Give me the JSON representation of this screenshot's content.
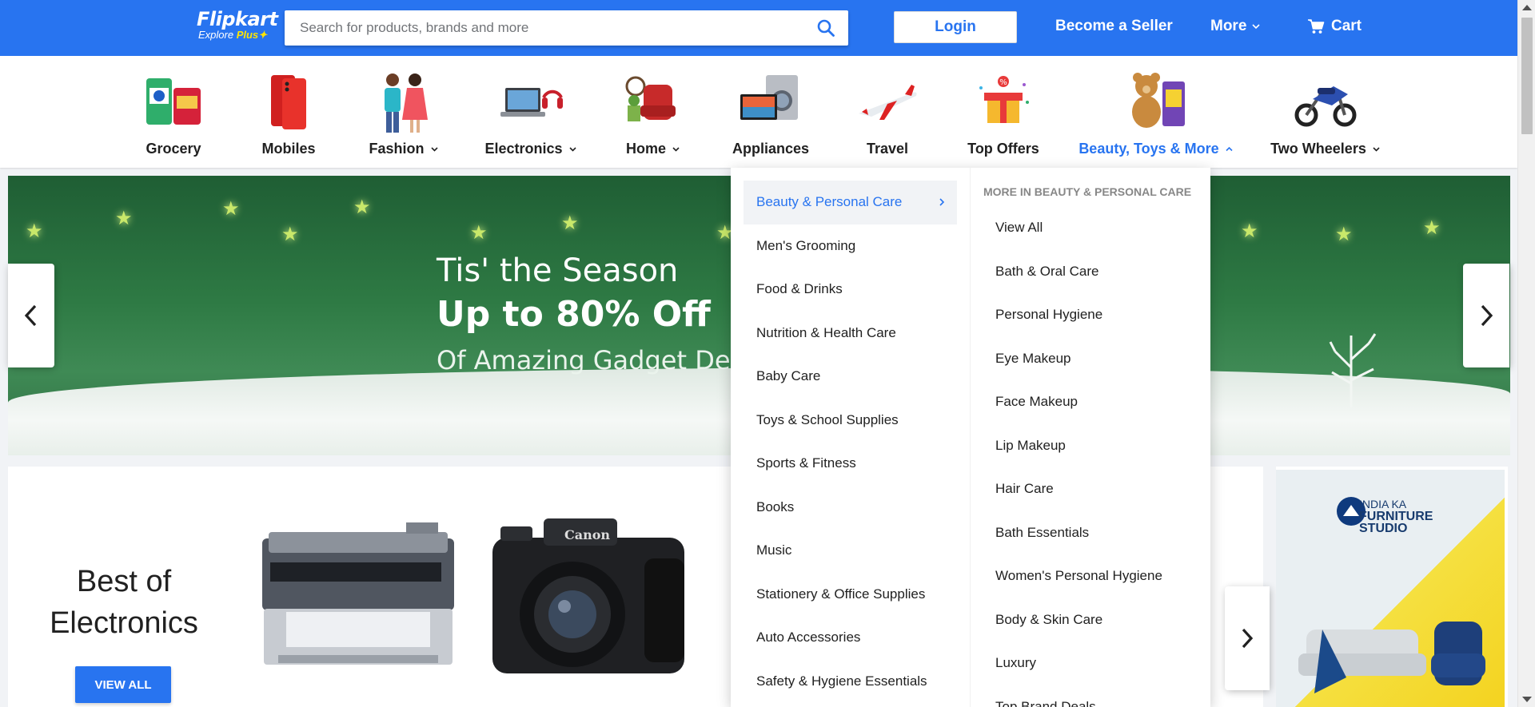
{
  "header": {
    "logo_text": "Flipkart",
    "logo_sub": "Explore",
    "logo_plus": "Plus",
    "search_placeholder": "Search for products, brands and more",
    "login_label": "Login",
    "seller_label": "Become a Seller",
    "more_label": "More",
    "cart_label": "Cart"
  },
  "categories": [
    {
      "label": "Grocery",
      "icon": "grocery-icon"
    },
    {
      "label": "Mobiles",
      "icon": "mobile-icon"
    },
    {
      "label": "Fashion",
      "icon": "fashion-icon",
      "dropdown": true
    },
    {
      "label": "Electronics",
      "icon": "laptop-icon",
      "dropdown": true
    },
    {
      "label": "Home",
      "icon": "home-furniture-icon",
      "dropdown": true
    },
    {
      "label": "Appliances",
      "icon": "appliances-icon"
    },
    {
      "label": "Travel",
      "icon": "airplane-icon"
    },
    {
      "label": "Top Offers",
      "icon": "gift-icon"
    },
    {
      "label": "Beauty, Toys & More",
      "icon": "teddy-bear-icon",
      "dropdown": true,
      "active": true
    },
    {
      "label": "Two Wheelers",
      "icon": "motorbike-icon",
      "dropdown": true
    }
  ],
  "banner": {
    "line1": "Tis' the Season",
    "line2": "Up to 80% Off",
    "line3": "Of Amazing Gadget Deals"
  },
  "best": {
    "title_line1": "Best of",
    "title_line2": "Electronics",
    "view_all": "VIEW ALL"
  },
  "ad": {
    "line1": "INDIA KA",
    "line2": "FURNITURE",
    "line3": "STUDIO"
  },
  "dropdown": {
    "left": [
      "Beauty & Personal Care",
      "Men's Grooming",
      "Food & Drinks",
      "Nutrition & Health Care",
      "Baby Care",
      "Toys & School Supplies",
      "Sports & Fitness",
      "Books",
      "Music",
      "Stationery & Office Supplies",
      "Auto Accessories",
      "Safety & Hygiene Essentials"
    ],
    "heading": "MORE IN BEAUTY & PERSONAL CARE",
    "right": [
      "View All",
      "Bath & Oral Care",
      "Personal Hygiene",
      "Eye Makeup",
      "Face Makeup",
      "Lip Makeup",
      "Hair Care",
      "Bath Essentials",
      "Women's Personal Hygiene",
      "Body & Skin Care",
      "Luxury",
      "Top Brand Deals"
    ]
  },
  "colors": {
    "brand": "#2874f0",
    "accent_yellow": "#ffe500"
  }
}
